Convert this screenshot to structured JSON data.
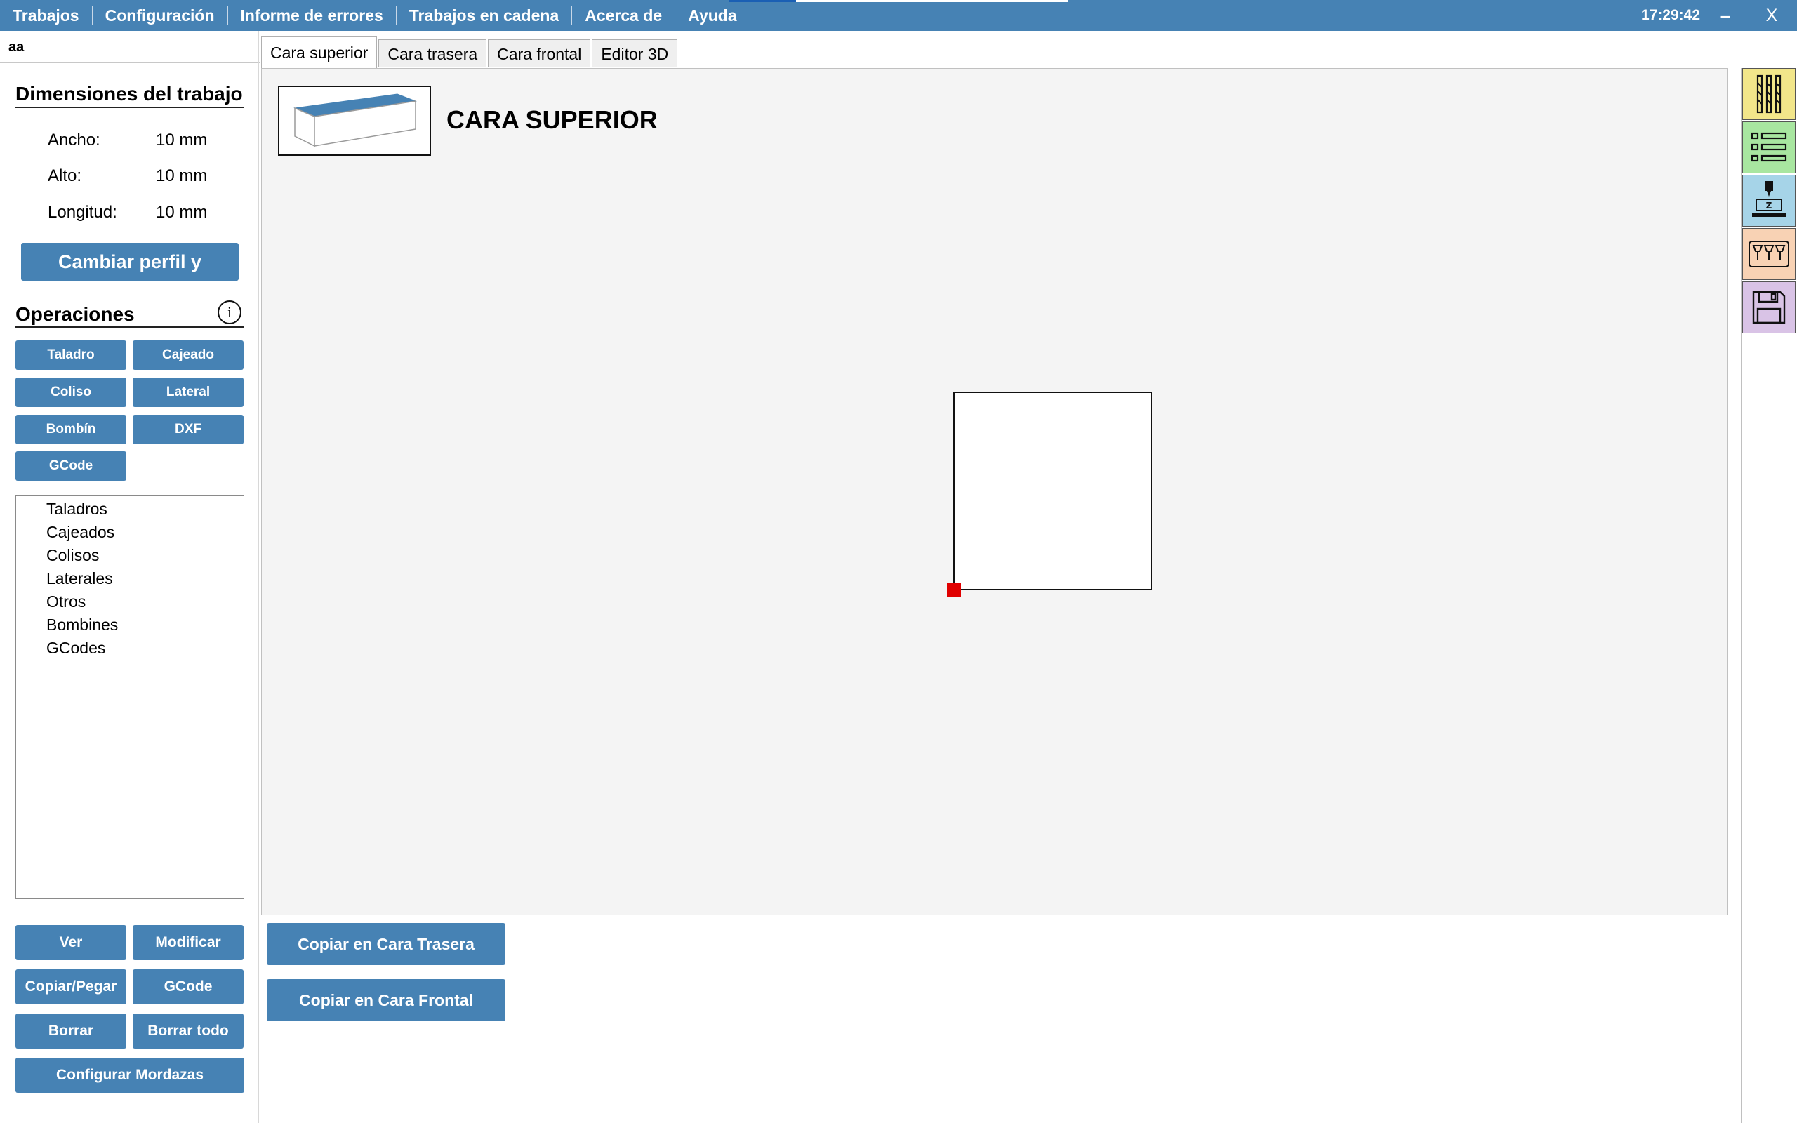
{
  "menubar": {
    "items": [
      "Trabajos",
      "Configuración",
      "Informe de errores",
      "Trabajos en cadena",
      "Acerca de",
      "Ayuda"
    ],
    "clock": "17:29:42",
    "minimize_label": "–",
    "close_label": "X"
  },
  "job": {
    "name": "aa"
  },
  "dimensions": {
    "title": "Dimensiones del trabajo",
    "ancho_label": "Ancho:",
    "ancho_value": "10 mm",
    "alto_label": "Alto:",
    "alto_value": "10 mm",
    "longitud_label": "Longitud:",
    "longitud_value": "10 mm",
    "change_button": "Cambiar perfil y longitud"
  },
  "operations": {
    "title": "Operaciones",
    "info_glyph": "i",
    "buttons": [
      "Taladro",
      "Cajeado",
      "Coliso",
      "Lateral",
      "Bombín",
      "DXF",
      "GCode"
    ],
    "list": [
      "Taladros",
      "Cajeados",
      "Colisos",
      "Laterales",
      "Otros",
      "Bombines",
      "GCodes"
    ],
    "actions": {
      "ver": "Ver",
      "modificar": "Modificar",
      "copiar_pegar": "Copiar/Pegar",
      "gcode": "GCode",
      "borrar": "Borrar",
      "borrar_todo": "Borrar todo",
      "configurar_mordazas": "Configurar Mordazas"
    }
  },
  "tabs": [
    "Cara superior",
    "Cara trasera",
    "Cara frontal",
    "Editor 3D"
  ],
  "canvas": {
    "face_title": "CARA SUPERIOR"
  },
  "copy_buttons": {
    "trasera": "Copiar en Cara Trasera",
    "frontal": "Copiar en Cara Frontal"
  },
  "side_toolbar": [
    {
      "icon": "tools-icon",
      "color": "#f2e68a"
    },
    {
      "icon": "list-icon",
      "color": "#a8e6a0"
    },
    {
      "icon": "machine-z-icon",
      "color": "#a6d4e8"
    },
    {
      "icon": "spindles-icon",
      "color": "#f8d2b4"
    },
    {
      "icon": "save-icon",
      "color": "#d9c3e6"
    }
  ],
  "colors": {
    "accent": "#4682b4",
    "origin": "#e00000",
    "canvas_bg": "#f4f4f4"
  }
}
